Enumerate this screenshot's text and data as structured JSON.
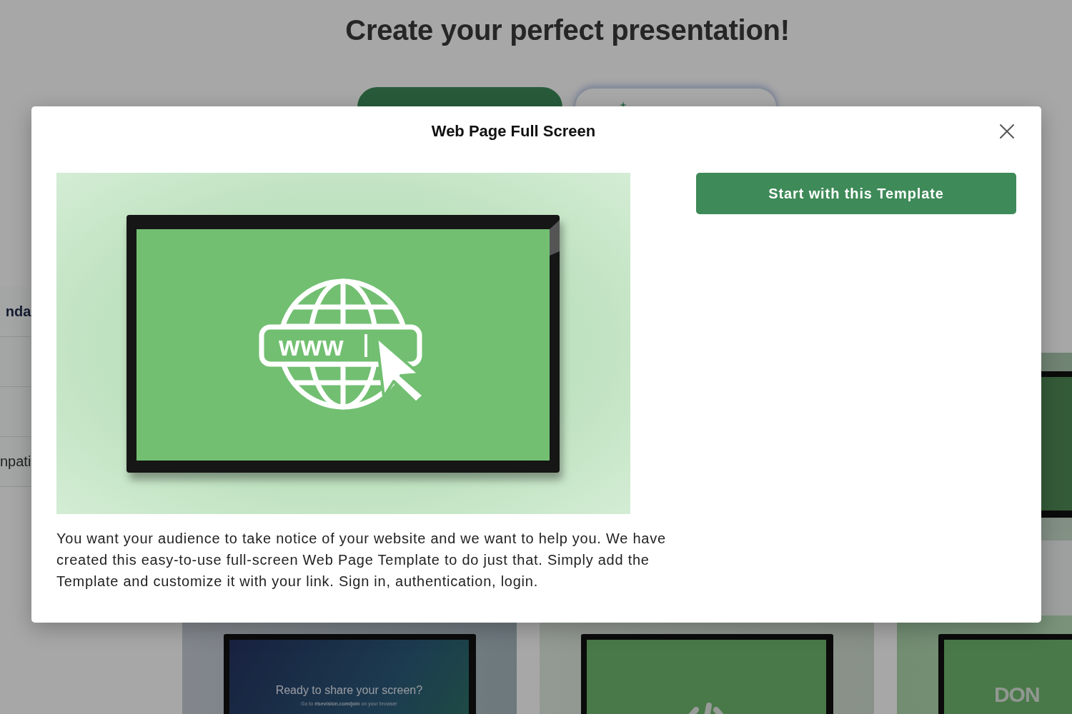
{
  "page": {
    "title": "Create your perfect presentation!"
  },
  "mode_buttons": [
    {
      "kind": "search",
      "selected": true
    },
    {
      "kind": "ai",
      "selected": false
    }
  ],
  "sidebar": {
    "items": [
      {
        "kind": "filter",
        "label": "nda",
        "selected": true
      },
      {
        "kind": "blank"
      },
      {
        "kind": "blank"
      },
      {
        "kind": "filter",
        "label": "npati",
        "selected": false
      }
    ]
  },
  "template_cards": [
    {
      "kind": "blank"
    },
    {
      "kind": "share",
      "heading": "Ready to share your screen?",
      "note": "Go to **risevision.com/join** on your browser"
    },
    {
      "kind": "code"
    },
    {
      "kind": "text",
      "heading": "DON"
    }
  ],
  "modal": {
    "title": "Web Page Full Screen",
    "preview_text": "www",
    "primary_button": "Start with this Template",
    "description": "You want your audience to take notice of your website and we want to help you. We have created this easy-to-use full-screen Web Page Template to do just that. Simply add the Template and customize it with your link. Sign in, authentication, login."
  }
}
